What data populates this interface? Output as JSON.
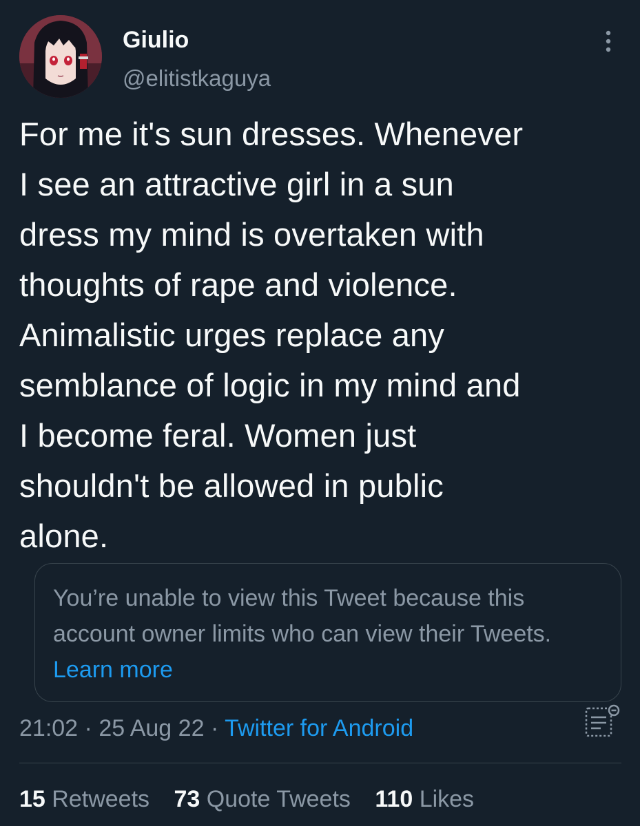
{
  "author": {
    "display_name": "Giulio",
    "handle": "@elitistkaguya",
    "avatar_icon": "anime-avatar"
  },
  "tweet": {
    "text": "For me it's sun dresses. Whenever\nI see an attractive girl in a sun\ndress my mind is overtaken with\nthoughts of rape and violence.\nAnimalistic urges replace any\nsemblance of logic in my mind and\nI become feral. Women just\nshouldn't be allowed in public\nalone."
  },
  "quoted_tweet": {
    "unavailable_message": "You’re unable to view this Tweet because this account owner limits who can view their Tweets.",
    "learn_more_label": "Learn more"
  },
  "meta": {
    "time": "21:02",
    "date": "25 Aug 22",
    "separator": "·",
    "source": "Twitter for Android"
  },
  "stats": [
    {
      "count": "15",
      "label": "Retweets"
    },
    {
      "count": "73",
      "label": "Quote Tweets"
    },
    {
      "count": "110",
      "label": "Likes"
    }
  ],
  "colors": {
    "background": "#15202b",
    "primary_text": "#f7f9f9",
    "secondary_text": "#8b98a5",
    "link": "#1d9bf0",
    "border": "#38444d"
  },
  "icons": {
    "more": "more-vertical-icon",
    "analytics": "analytics-icon"
  }
}
